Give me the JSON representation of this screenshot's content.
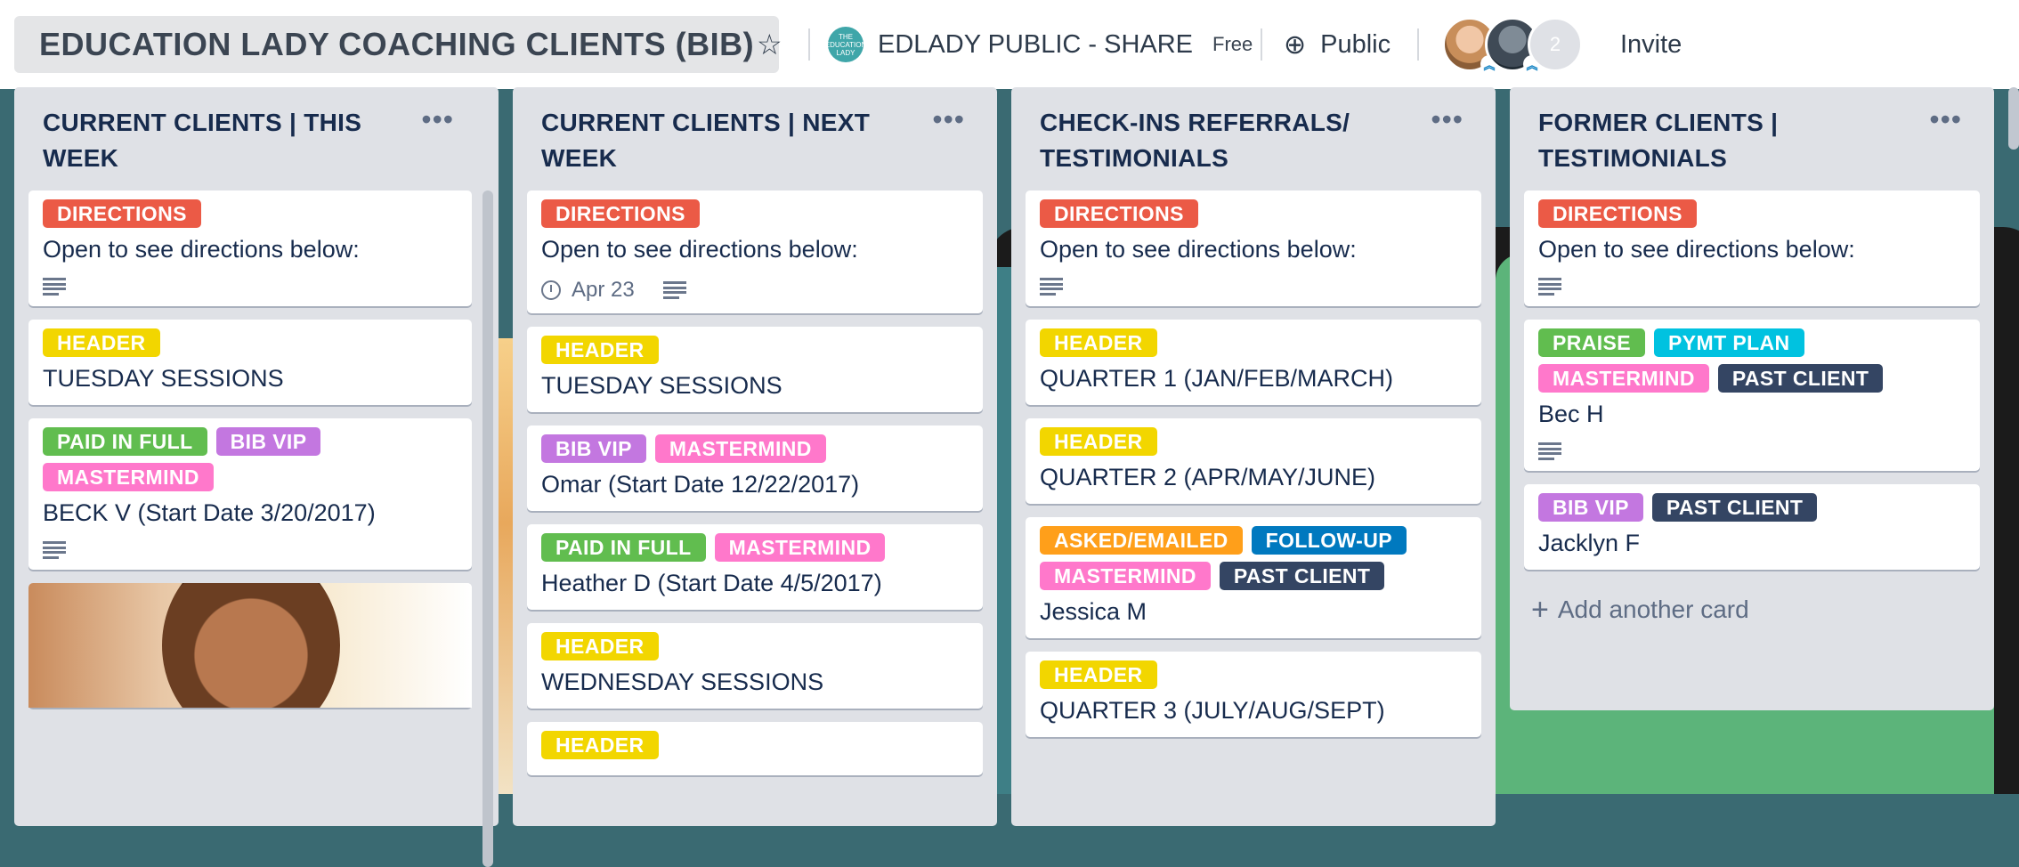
{
  "board": {
    "title": "EDUCATION LADY COACHING CLIENTS (BIB)",
    "star_icon": "star-icon",
    "team_name": "EDLADY PUBLIC - SHARE",
    "team_logo_text": "THE EDUCATION LADY",
    "plan": "Free",
    "visibility": "Public",
    "member_overflow": "2",
    "invite_label": "Invite"
  },
  "colors": {
    "red": "#eb5a46",
    "yellow": "#f2d600",
    "green": "#61bd4f",
    "purple": "#c377e0",
    "pink": "#ff78cb",
    "sky": "#00c2e0",
    "orange": "#ff9f1a",
    "blue": "#0079bf",
    "black": "#344563"
  },
  "lists": [
    {
      "title": "CURRENT CLIENTS | THIS WEEK",
      "cards": [
        {
          "labels": [
            {
              "text": "DIRECTIONS",
              "color": "red"
            }
          ],
          "title": "Open to see directions below:",
          "description": true
        },
        {
          "labels": [
            {
              "text": "HEADER",
              "color": "yellow"
            }
          ],
          "title": "TUESDAY SESSIONS"
        },
        {
          "labels": [
            {
              "text": "PAID IN FULL",
              "color": "green"
            },
            {
              "text": "BIB VIP",
              "color": "purple"
            },
            {
              "text": "MASTERMIND",
              "color": "pink"
            }
          ],
          "title": "BECK V (Start Date 3/20/2017)",
          "description": true
        },
        {
          "cover": true
        }
      ]
    },
    {
      "title": "CURRENT CLIENTS | NEXT WEEK",
      "cards": [
        {
          "labels": [
            {
              "text": "DIRECTIONS",
              "color": "red"
            }
          ],
          "title": "Open to see directions below:",
          "due": "Apr 23",
          "description": true
        },
        {
          "labels": [
            {
              "text": "HEADER",
              "color": "yellow"
            }
          ],
          "title": "TUESDAY SESSIONS"
        },
        {
          "labels": [
            {
              "text": "BIB VIP",
              "color": "purple"
            },
            {
              "text": "MASTERMIND",
              "color": "pink"
            }
          ],
          "title": "Omar (Start Date 12/22/2017)"
        },
        {
          "labels": [
            {
              "text": "PAID IN FULL",
              "color": "green"
            },
            {
              "text": "MASTERMIND",
              "color": "pink"
            }
          ],
          "title": "Heather D (Start Date 4/5/2017)"
        },
        {
          "labels": [
            {
              "text": "HEADER",
              "color": "yellow"
            }
          ],
          "title": "WEDNESDAY SESSIONS"
        },
        {
          "labels": [
            {
              "text": "HEADER",
              "color": "yellow"
            }
          ],
          "title": ""
        }
      ]
    },
    {
      "title": "CHECK-INS REFERRALS/ TESTIMONIALS",
      "cards": [
        {
          "labels": [
            {
              "text": "DIRECTIONS",
              "color": "red"
            }
          ],
          "title": "Open to see directions below:",
          "description": true
        },
        {
          "labels": [
            {
              "text": "HEADER",
              "color": "yellow"
            }
          ],
          "title": "QUARTER 1 (JAN/FEB/MARCH)"
        },
        {
          "labels": [
            {
              "text": "HEADER",
              "color": "yellow"
            }
          ],
          "title": "QUARTER 2 (APR/MAY/JUNE)"
        },
        {
          "labels": [
            {
              "text": "ASKED/EMAILED",
              "color": "orange"
            },
            {
              "text": "FOLLOW-UP",
              "color": "blue"
            },
            {
              "text": "MASTERMIND",
              "color": "pink"
            },
            {
              "text": "PAST CLIENT",
              "color": "black"
            }
          ],
          "title": "Jessica M"
        },
        {
          "labels": [
            {
              "text": "HEADER",
              "color": "yellow"
            }
          ],
          "title": "QUARTER 3 (JULY/AUG/SEPT)"
        }
      ]
    },
    {
      "title": "FORMER CLIENTS | TESTIMONIALS",
      "cards": [
        {
          "labels": [
            {
              "text": "DIRECTIONS",
              "color": "red"
            }
          ],
          "title": "Open to see directions below:",
          "description": true
        },
        {
          "labels": [
            {
              "text": "PRAISE",
              "color": "green"
            },
            {
              "text": "PYMT PLAN",
              "color": "sky"
            },
            {
              "text": "MASTERMIND",
              "color": "pink"
            },
            {
              "text": "PAST CLIENT",
              "color": "black"
            }
          ],
          "title": "Bec H",
          "description": true
        },
        {
          "labels": [
            {
              "text": "BIB VIP",
              "color": "purple"
            },
            {
              "text": "PAST CLIENT",
              "color": "black"
            }
          ],
          "title": "Jacklyn F"
        }
      ],
      "add_card_label": "Add another card"
    }
  ]
}
